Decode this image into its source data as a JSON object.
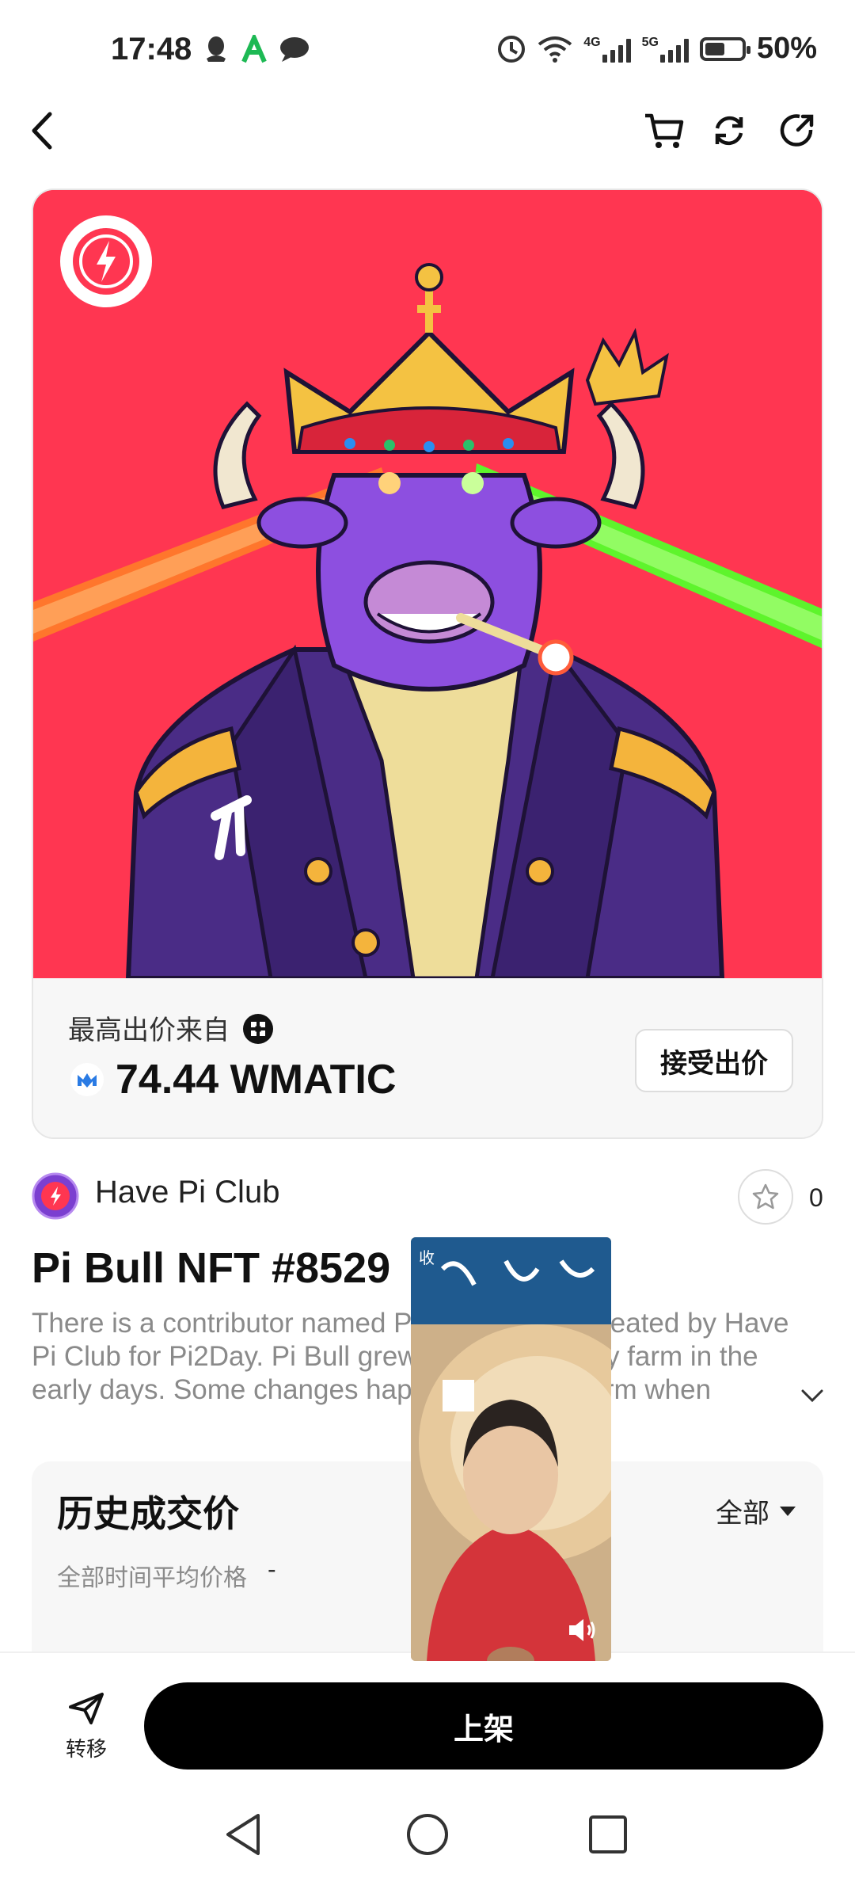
{
  "status_bar": {
    "time": "17:48",
    "battery": "50%",
    "net_4g": "4G",
    "net_5g": "5G",
    "icons": [
      "qq-icon",
      "app-a-icon",
      "chat-bubble-icon",
      "alarm-icon",
      "wifi-icon",
      "signal-4g-icon",
      "signal-5g-icon",
      "battery-icon"
    ]
  },
  "nav": {
    "icons": [
      "back-icon",
      "cart-icon",
      "refresh-icon",
      "share-icon"
    ]
  },
  "bid": {
    "label": "最高出价来自",
    "amount": "74.44 WMATIC",
    "accept_label": "接受出价"
  },
  "collection": {
    "name": "Have Pi Club",
    "favorites": "0"
  },
  "nft": {
    "title": "Pi Bull NFT #8529",
    "description": "There is a contributor named Pi Bull, an NFT created by Have Pi Club for Pi2Day. Pi Bull grew up on a wealthy farm in the early days. Some changes happened on the farm when"
  },
  "history": {
    "title": "历史成交价",
    "filter": "全部",
    "avg_label": "全部时间平均价格",
    "avg_value": "-"
  },
  "bottom": {
    "transfer_label": "转移",
    "list_label": "上架"
  },
  "video": {
    "badge": "收"
  },
  "colors": {
    "art_bg": "#ff3651",
    "button_bg": "#000000",
    "muted_text": "#8a8a8a"
  }
}
